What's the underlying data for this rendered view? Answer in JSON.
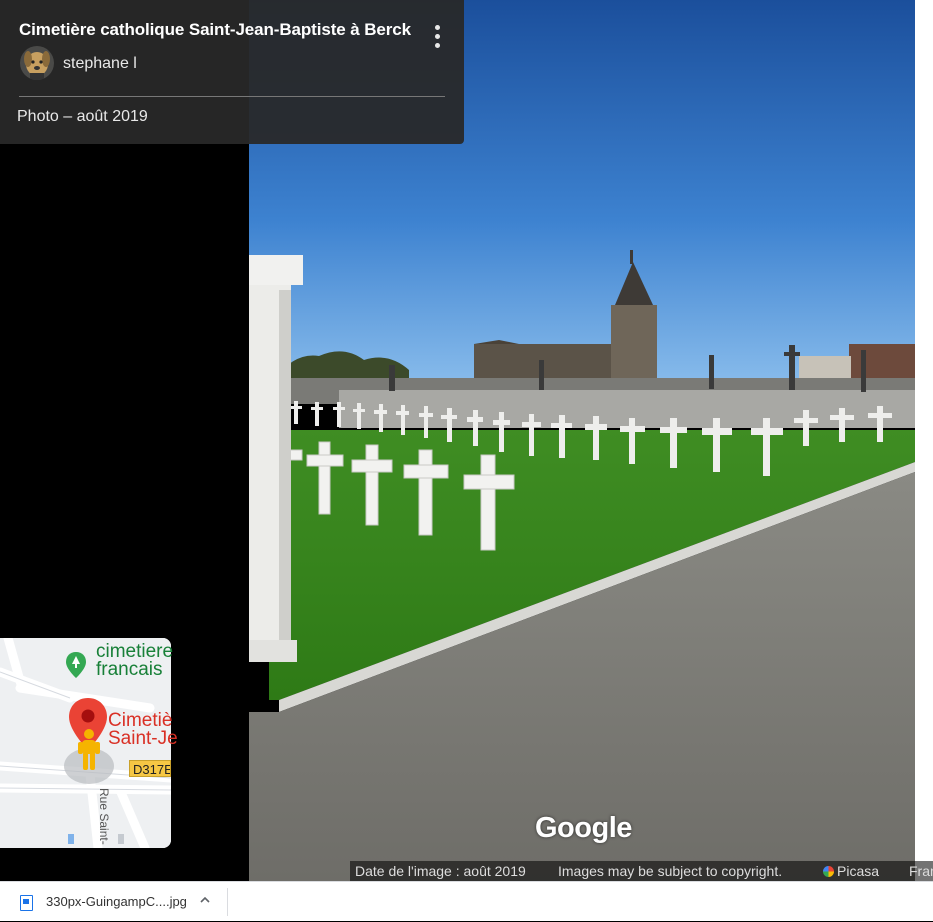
{
  "info_card": {
    "title": "Cimetière catholique Saint-Jean-Baptiste à Berck",
    "author": "stephane l",
    "photo_date": "Photo – août 2019",
    "more_icon": "more-vert-icon",
    "avatar_icon": "dog-avatar-icon"
  },
  "minimap": {
    "poi_green_line1": "cimetiere",
    "poi_green_line2": "francais",
    "poi_red_line1": "Cimetiè",
    "poi_red_line2": "Saint-Je",
    "road_shield": "D317E",
    "street": "Rue Saint-",
    "pin_color": "#ea4335",
    "pegman_color": "#f5b400"
  },
  "watermark": "Google",
  "attribution": {
    "image_date": "Date de l'image : août 2019",
    "copyright": "Images may be subject to copyright.",
    "picasa": "Picasa",
    "country": "Fran"
  },
  "download_bar": {
    "file_name": "330px-GuingampC....jpg",
    "file_icon": "image-file-icon",
    "chevron_icon": "chevron-up-icon"
  }
}
